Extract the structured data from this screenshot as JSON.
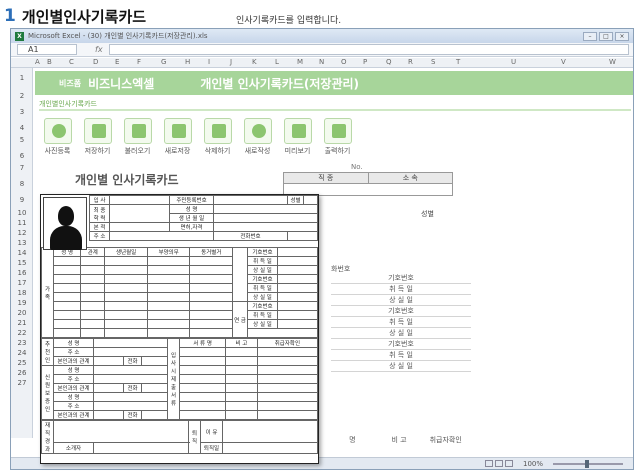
{
  "heading": {
    "number": "1",
    "title": "개인별인사기록카드"
  },
  "instruction": "인사기록카드를 입력합니다.",
  "window": {
    "title": "Microsoft Excel - (30) 개인별 인사기록카드(저장관리).xls"
  },
  "formula_bar": {
    "name_box": "A1",
    "fx": "fx"
  },
  "columns": [
    "A",
    "B",
    "C",
    "D",
    "E",
    "F",
    "G",
    "H",
    "I",
    "J",
    "K",
    "L",
    "M",
    "N",
    "O",
    "P",
    "Q",
    "R",
    "S",
    "T",
    "U",
    "V",
    "W"
  ],
  "rows": [
    "1",
    "2",
    "3",
    "4",
    "5",
    "6",
    "7",
    "8",
    "9",
    "10",
    "11",
    "12",
    "13",
    "14",
    "15",
    "16",
    "17",
    "18",
    "19",
    "20",
    "21",
    "22",
    "23",
    "24",
    "25",
    "26",
    "27"
  ],
  "banner": {
    "small": "비즈폼",
    "brand": "비즈니스엑셀",
    "main": "개인별 인사기록카드(저장관리)"
  },
  "breadcrumb": "개인별인사기록카드",
  "toolbar": [
    {
      "label": "사진등록",
      "icon": "person-icon"
    },
    {
      "label": "저장하기",
      "icon": "pencil-icon"
    },
    {
      "label": "불러오기",
      "icon": "import-icon"
    },
    {
      "label": "새로저장",
      "icon": "disk-icon"
    },
    {
      "label": "삭제하기",
      "icon": "trash-icon"
    },
    {
      "label": "새로작성",
      "icon": "refresh-icon"
    },
    {
      "label": "미리보기",
      "icon": "monitor-icon"
    },
    {
      "label": "출력하기",
      "icon": "printer-icon"
    }
  ],
  "no_label": "No.",
  "card_title": "개인별 인사기록카드",
  "position_table": {
    "col1": "직 종",
    "col2": "소 속"
  },
  "background": {
    "seongbyeol": "성별",
    "partial_phone": "화번호",
    "side_labels": [
      "기호번호",
      "취 득 일",
      "상 실 일",
      "기호번호",
      "취 득 일",
      "상 실 일",
      "기호번호",
      "취 득 일",
      "상 실 일"
    ],
    "bottom_headers": [
      "명",
      "비 고",
      "취급자확인"
    ]
  },
  "card": {
    "r1": [
      "입 사",
      "주민등록번호",
      "성별"
    ],
    "r2": [
      "최 종 학 력",
      "성 명"
    ],
    "r3": [
      "생 년 월 일"
    ],
    "r4": [
      "본 적",
      "면허,자격"
    ],
    "r5": [
      "주 소",
      "전화번호"
    ],
    "family_label": "가 족",
    "family_headers": [
      "성 명",
      "관계",
      "생년월일",
      "부양의무",
      "동거별거"
    ],
    "insurance_labels": [
      "기호번호",
      "취 득 일",
      "상 실 일",
      "기호번호",
      "취 득 일",
      "상 실 일",
      "기호번호",
      "취 득 일",
      "상 실 일"
    ],
    "pension_label": "연 금",
    "pension_label2": "연 금",
    "guarantor1": "추 천 인",
    "guarantor2": "신 원 보 증 인",
    "g_name": "성 명",
    "g_addr": "주 소",
    "g_rel": "본인과의 관계",
    "g_phone": "전화",
    "docs_label": "입 사 시 제 출 서 류",
    "docs_headers": [
      "서 류 명",
      "비 고",
      "취급자확인"
    ],
    "retire_label": "퇴 직",
    "retire_reason": "이 유",
    "retire_date": "퇴직일",
    "reentry_label": "재 직 경 과",
    "introducer": "소개자"
  },
  "status": {
    "zoom": "100%"
  }
}
